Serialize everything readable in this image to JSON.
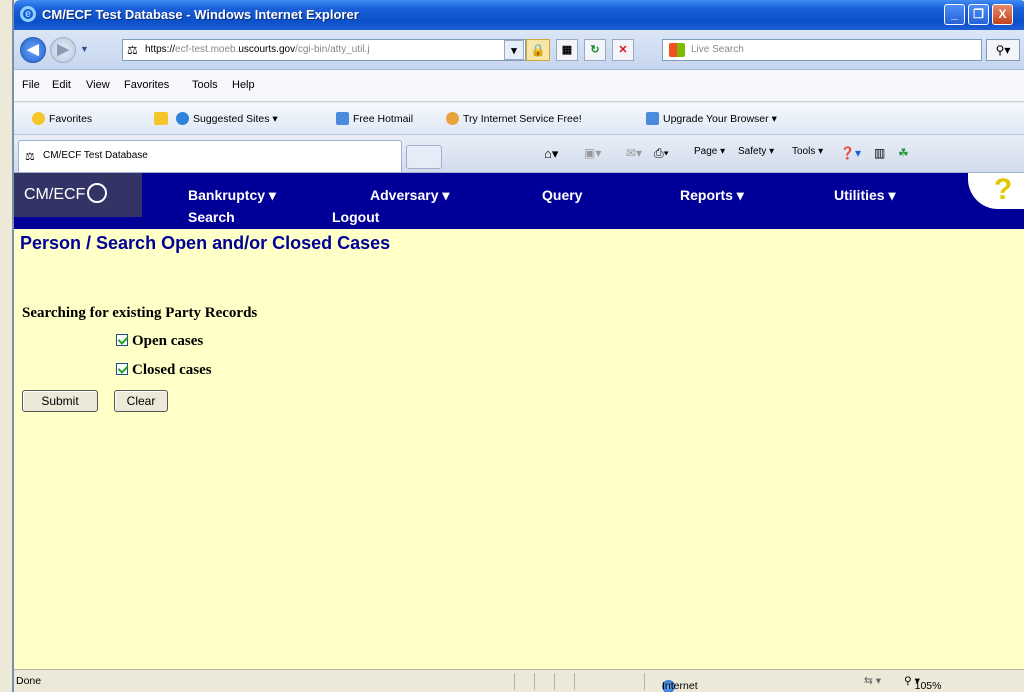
{
  "window": {
    "title": "CM/ECF Test Database - Windows Internet Explorer",
    "minimize": "_",
    "maximize": "❐",
    "close": "X"
  },
  "address": {
    "prefix": "https://",
    "pre_host": "ecf-test.moeb.",
    "host": "uscourts.gov",
    "path": "/cgi-bin/atty_util.j",
    "search_placeholder": "Live Search"
  },
  "menu": [
    "File",
    "Edit",
    "View",
    "Favorites",
    "Tools",
    "Help"
  ],
  "favorites_bar": {
    "favorites_label": "Favorites",
    "items": [
      "Suggested Sites ▾",
      "Free Hotmail",
      "Try Internet Service Free!",
      "Upgrade Your Browser ▾"
    ]
  },
  "tab": {
    "label": "CM/ECF Test Database"
  },
  "command_bar": {
    "page": "Page ▾",
    "safety": "Safety ▾",
    "tools": "Tools ▾"
  },
  "cmecf": {
    "logo_text": "CM/ECF",
    "nav_row1": [
      "Bankruptcy ▾",
      "Adversary ▾",
      "Query",
      "Reports ▾",
      "Utilities ▾"
    ],
    "nav_row2": [
      "Search",
      "Logout"
    ],
    "help": "?"
  },
  "page": {
    "title": "Person / Search Open and/or Closed Cases",
    "section": "Searching for existing Party Records",
    "options": [
      {
        "label": "Open cases",
        "checked": true
      },
      {
        "label": "Closed cases",
        "checked": true
      }
    ],
    "submit": "Submit",
    "clear": "Clear"
  },
  "status": {
    "left": "Done",
    "zone": "Internet",
    "zoom": "105%"
  }
}
